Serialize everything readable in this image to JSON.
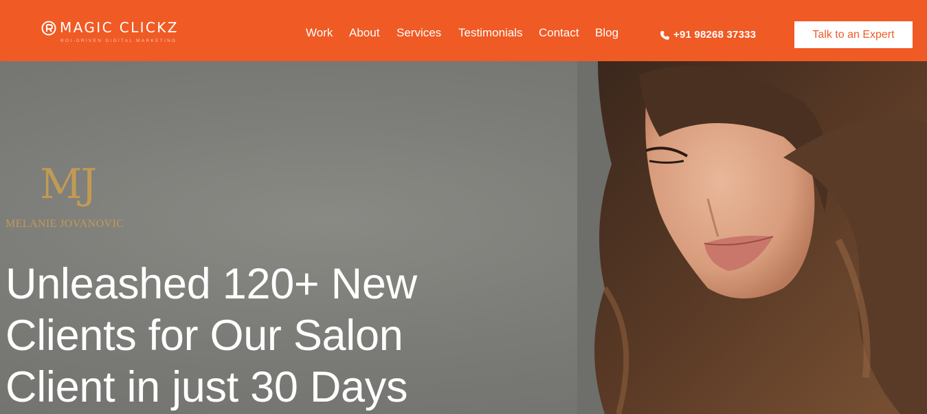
{
  "header": {
    "logo_text": "MAGIC CLICKZ",
    "logo_tagline": "ROI-DRIVEN DIGITAL MARKETING",
    "nav": [
      "Work",
      "About",
      "Services",
      "Testimonials",
      "Contact",
      "Blog"
    ],
    "phone": "+91 98268 37333",
    "phone_icon": "phone-icon",
    "cta_label": "Talk to an Expert"
  },
  "hero": {
    "client_logo_monogram": "MJ",
    "client_logo_name": "MELANIE JOVANOVIC",
    "headline_lines": [
      "Unleashed 120+ New",
      "Clients for Our Salon",
      "Client in just 30 Days"
    ]
  },
  "colors": {
    "brand_orange": "#f05a24",
    "hero_background": "#7d7d7a",
    "client_gold": "#c19a55",
    "text_white": "#ffffff"
  }
}
